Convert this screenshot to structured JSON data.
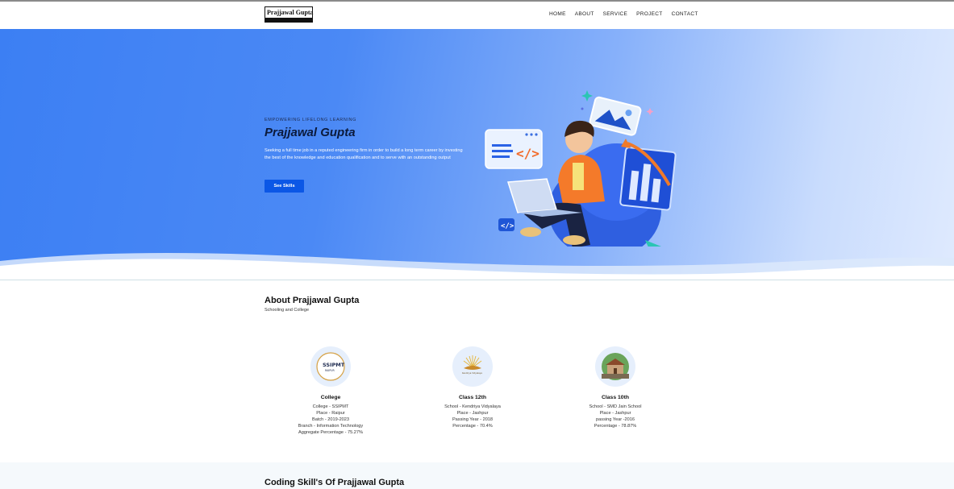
{
  "nav": {
    "logo_text": "Prajjawal Gupta",
    "items": [
      {
        "label": "HOME"
      },
      {
        "label": "ABOUT"
      },
      {
        "label": "SERVICE"
      },
      {
        "label": "PROJECT"
      },
      {
        "label": "CONTACT"
      }
    ]
  },
  "hero": {
    "eyebrow": "EMPOWERING LIFELONG LEARNING",
    "title": "Prajjawal Gupta",
    "description": "Seeking a full time job in a reputed engineering firm in order to build a long term career by investing the best of the knowledge and education qualification and to serve with an outstanding output",
    "button_label": "See Skills"
  },
  "about": {
    "title": "About Prajjawal Gupta",
    "subtitle": "Schooling and College",
    "cards": [
      {
        "logo_text": "SSIPMT",
        "logo_sub": "RAIPUR",
        "title": "College",
        "lines": [
          "College - SSIPMT",
          "Place - Raipur",
          "Batch - 2019-2023",
          "Branch - Information Technology",
          "Aggregate Percentage - 75.27%"
        ]
      },
      {
        "logo_text": "Kendriya Vidyalaya",
        "title": "Class 12th",
        "lines": [
          "School - Kendriya Vidyalaya",
          "Place - Jashpur",
          "Passing Year - 2018",
          "Percentage - 70.4%"
        ]
      },
      {
        "title": "Class 10th",
        "lines": [
          "School - SMD Jain School",
          "Place - Jashpur",
          "passing Year -2016",
          "Percentage - 78.87%"
        ]
      }
    ]
  },
  "skills": {
    "title": "Coding Skill's Of Prajjawal Gupta"
  },
  "colors": {
    "accent": "#0b57e6",
    "hero_gradient_start": "#3c7ff3",
    "hero_gradient_end": "#dfeafe"
  }
}
